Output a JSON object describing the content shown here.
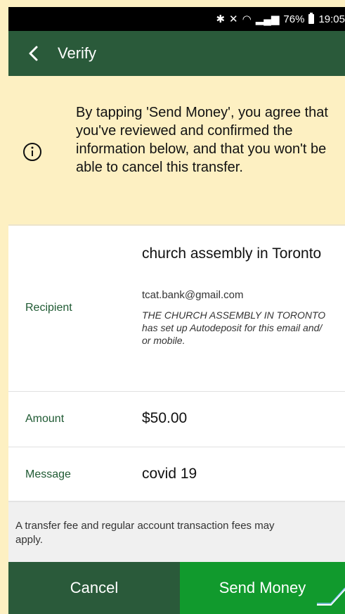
{
  "status_bar": {
    "icons": [
      "bluetooth-icon",
      "mute-icon",
      "wifi-icon",
      "signal-icon"
    ],
    "battery": "76%",
    "time": "19:05"
  },
  "app_bar": {
    "title": "Verify"
  },
  "notice": {
    "text": "By tapping 'Send Money', you agree that you've reviewed and confirmed the information below, and that you won't be able to cancel this transfer."
  },
  "details": {
    "recipient_label": "Recipient",
    "recipient_name": "church assembly in Toronto",
    "recipient_email": "tcat.bank@gmail.com",
    "recipient_note": "THE CHURCH ASSEMBLY IN TORONTO has set up Autodeposit for this email and/ or mobile.",
    "amount_label": "Amount",
    "amount_value": "$50.00",
    "message_label": "Message",
    "message_value": "covid 19"
  },
  "fee_note": {
    "text": "A transfer fee and regular account transaction fees may apply."
  },
  "buttons": {
    "cancel": "Cancel",
    "send": "Send Money"
  },
  "colors": {
    "green_dark": "#2a5a3a",
    "green_bright": "#119a2d",
    "notice_bg": "#fdf0c2",
    "label_green": "#1f5a33"
  }
}
